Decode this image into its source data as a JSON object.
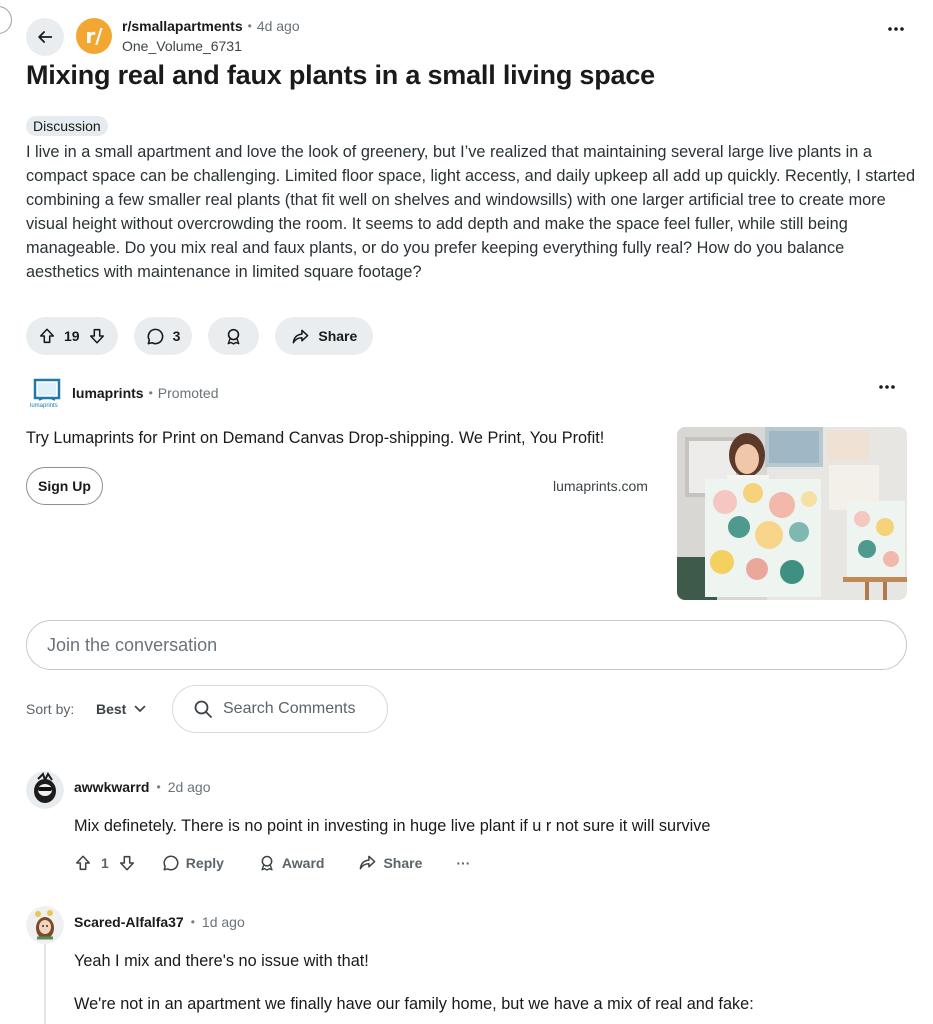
{
  "post": {
    "subreddit": "r/smallapartments",
    "age": "4d ago",
    "author": "One_Volume_6731",
    "title": "Mixing real and faux plants in a small living space",
    "flair": "Discussion",
    "body": "I live in a small apartment and love the look of greenery, but I’ve realized that maintaining several large live plants in a compact space can be challenging. Limited floor space, light access, and daily upkeep all add up quickly. Recently, I started combining a few smaller real plants (that fit well on shelves and windowsills) with one larger artificial tree to create more visual height without overcrowding the room. It seems to add depth and make the space feel fuller, while still being manageable. Do you mix real and faux plants, or do you prefer keeping everything fully real? How do you balance aesthetics with maintenance in limited square footage?",
    "votes": "19",
    "comments": "3",
    "share_label": "Share",
    "avatar_letter": "r/"
  },
  "promo": {
    "advertiser": "lumaprints",
    "label": "Promoted",
    "logo_text": "lumaprints",
    "text": "Try Lumaprints for Print on Demand Canvas Drop-shipping. We Print, You Profit!",
    "cta": "Sign Up",
    "domain": "lumaprints.com"
  },
  "composer": {
    "placeholder": "Join the conversation"
  },
  "sort": {
    "label": "Sort by:",
    "value": "Best",
    "search_placeholder": "Search Comments"
  },
  "comments": [
    {
      "user": "awwkwarrd",
      "age": "2d ago",
      "text": "Mix definetely. There is no point in investing in huge live plant if u r not sure it will survive",
      "votes": "1",
      "reply": "Reply",
      "award": "Award",
      "share": "Share",
      "more": "···"
    },
    {
      "user": "Scared-Alfalfa37",
      "age": "1d ago",
      "text": "Yeah I mix and there's no issue with that!",
      "text2": "We're not in an apartment we finally have our family home, but we have a mix of real and fake:"
    }
  ],
  "colors": {
    "subreddit_avatar": "#f3a733",
    "pill_bg": "#eaedef",
    "text": "#1a1a1b",
    "muted": "#6b7379"
  },
  "icons": [
    "back-arrow-icon",
    "upvote-icon",
    "downvote-icon",
    "comment-icon",
    "award-icon",
    "share-icon",
    "search-icon",
    "chevron-down-icon",
    "more-icon"
  ]
}
